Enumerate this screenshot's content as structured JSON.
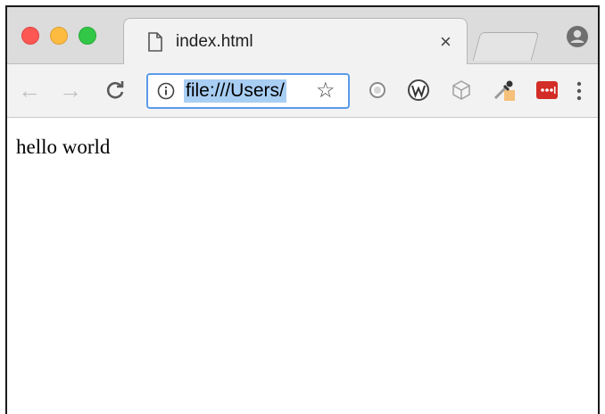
{
  "window": {
    "traffic_lights": [
      "close",
      "minimize",
      "zoom"
    ]
  },
  "tab": {
    "title": "index.html",
    "icon": "document-icon",
    "close_label": "×"
  },
  "toolbar": {
    "back_icon": "←",
    "forward_icon": "→",
    "reload_icon": "C",
    "address": {
      "url": "file:///Users/",
      "info_icon": "info-icon",
      "bookmark_icon": "☆"
    },
    "extensions": [
      "grey-circle-extension-icon",
      "w-extension-icon",
      "box-extension-icon",
      "eyedropper-extension-icon",
      "lastpass-extension-icon"
    ],
    "menu_icon": "more-vertical-icon"
  },
  "page": {
    "body_text": "hello world"
  },
  "colors": {
    "close": "#fc5753",
    "minimize": "#fdbc40",
    "zoom": "#33c748",
    "omnibox_focus": "#5a9be8",
    "url_selection": "#a9cef3",
    "lastpass_red": "#d32d27"
  }
}
